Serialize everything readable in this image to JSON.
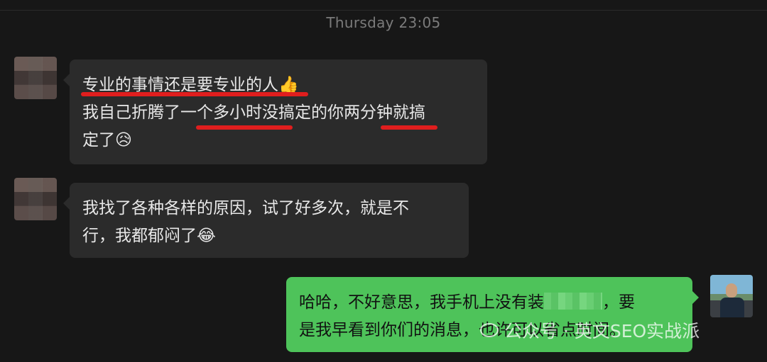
{
  "chat": {
    "timestamp": "Thursday 23:05",
    "messages": [
      {
        "side": "incoming",
        "lines": [
          "专业的事情还是要专业的人👍",
          "我自己折腾了一个多小时没搞定的你两分钟就搞",
          "定了😥"
        ]
      },
      {
        "side": "incoming",
        "lines": [
          "我找了各种各样的原因，试了好多次，就是不",
          "行，我都郁闷了😂"
        ]
      },
      {
        "side": "outgoing",
        "line1_before": "哈哈，不好意思，我手机上没有装",
        "line1_after": "，要",
        "line2": "是我早看到你们的消息，也许可以省点时间。"
      }
    ],
    "highlight_color": "#e01e1e"
  },
  "watermark": {
    "text": "公众号 · 英文SEO实战派",
    "icon": "wechat-icon"
  }
}
